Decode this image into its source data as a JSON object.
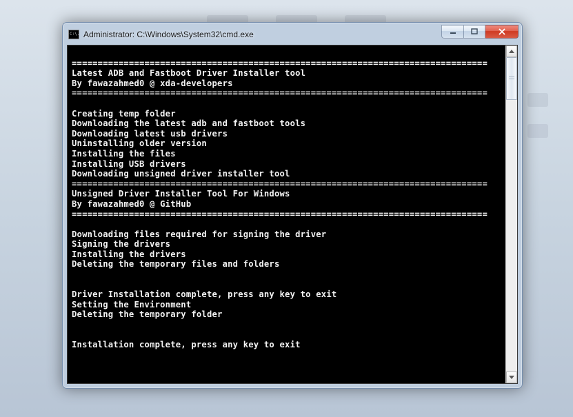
{
  "window": {
    "title": "Administrator: C:\\Windows\\System32\\cmd.exe",
    "icon_label": "C:\\."
  },
  "controls": {
    "minimize": "Minimize",
    "maximize": "Maximize",
    "close": "Close"
  },
  "console": {
    "lines": [
      "",
      "================================================================================",
      "Latest ADB and Fastboot Driver Installer tool",
      "By fawazahmed0 @ xda-developers",
      "================================================================================",
      "",
      "Creating temp folder",
      "Downloading the latest adb and fastboot tools",
      "Downloading latest usb drivers",
      "Uninstalling older version",
      "Installing the files",
      "Installing USB drivers",
      "Downloading unsigned driver installer tool",
      "================================================================================",
      "Unsigned Driver Installer Tool For Windows",
      "By fawazahmed0 @ GitHub",
      "================================================================================",
      "",
      "Downloading files required for signing the driver",
      "Signing the drivers",
      "Installing the drivers",
      "Deleting the temporary files and folders",
      "",
      "",
      "Driver Installation complete, press any key to exit",
      "Setting the Environment",
      "Deleting the temporary folder",
      "",
      "",
      "Installation complete, press any key to exit"
    ]
  }
}
